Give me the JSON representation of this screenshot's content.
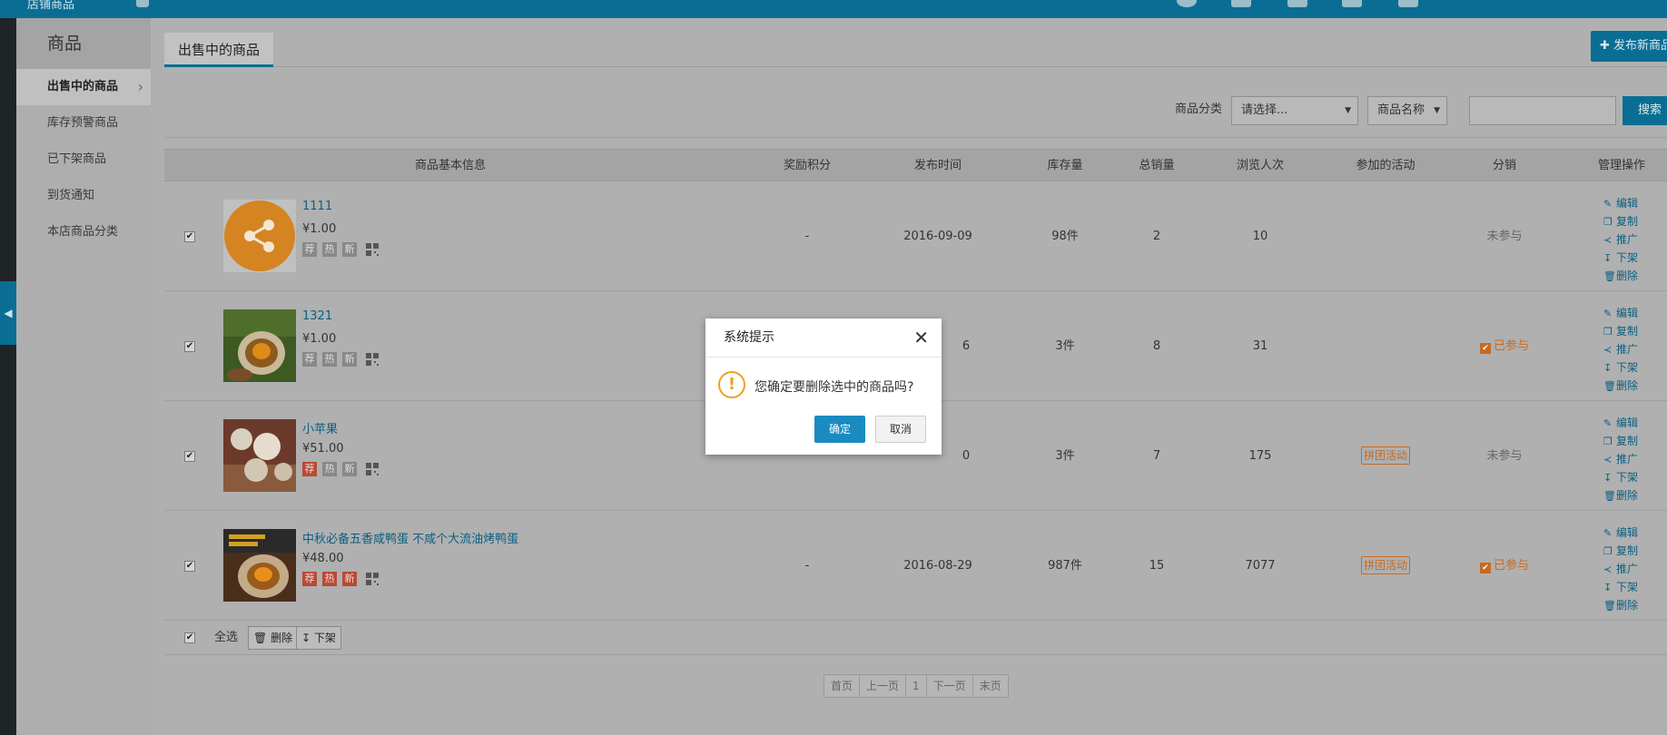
{
  "topbar": {
    "title": "店铺商品"
  },
  "sidebar": {
    "heading": "商品",
    "items": [
      {
        "label": "出售中的商品",
        "active": true
      },
      {
        "label": "库存预警商品"
      },
      {
        "label": "已下架商品"
      },
      {
        "label": "到货通知"
      },
      {
        "label": "本店商品分类"
      }
    ]
  },
  "tab": {
    "label": "出售中的商品"
  },
  "publish_button": "发布新商品",
  "filter": {
    "category_label": "商品分类",
    "category_value": "请选择...",
    "field_value": "商品名称",
    "keyword_value": "",
    "search_label": "搜索"
  },
  "table": {
    "headers": [
      "商品基本信息",
      "奖励积分",
      "发布时间",
      "库存量",
      "总销量",
      "浏览人次",
      "参加的活动",
      "分销",
      "管理操作"
    ],
    "rows": [
      {
        "name": "1111",
        "price": "¥1.00",
        "points": "-",
        "date": "2016-09-09",
        "stock": "98件",
        "sales": "2",
        "views": "10",
        "activity": "",
        "distribution": "未参与",
        "distributed": false,
        "tags": [
          "荐",
          "热",
          "新"
        ],
        "red_tags": []
      },
      {
        "name": "1321",
        "price": "¥1.00",
        "points": "",
        "date": "6",
        "stock": "3件",
        "sales": "8",
        "views": "31",
        "activity": "",
        "distribution": "已参与",
        "distributed": true,
        "tags": [
          "荐",
          "热",
          "新"
        ],
        "red_tags": []
      },
      {
        "name": "小苹果",
        "price": "¥51.00",
        "points": "",
        "date": "0",
        "stock": "3件",
        "sales": "7",
        "views": "175",
        "activity": "拼团活动",
        "distribution": "未参与",
        "distributed": false,
        "tags": [
          "荐",
          "热",
          "新"
        ],
        "red_tags": [
          "荐"
        ]
      },
      {
        "name": "中秋必备五香咸鸭蛋 不咸个大流油烤鸭蛋",
        "price": "¥48.00",
        "points": "-",
        "date": "2016-08-29",
        "stock": "987件",
        "sales": "15",
        "views": "7077",
        "activity": "拼团活动",
        "distribution": "已参与",
        "distributed": true,
        "tags": [
          "荐",
          "热",
          "新"
        ],
        "red_tags": [
          "荐",
          "热",
          "新"
        ]
      }
    ],
    "ops": [
      "编辑",
      "复制",
      "推广",
      "下架",
      "删除"
    ]
  },
  "bulk": {
    "select_all": "全选",
    "delete": "删除",
    "unshelve": "下架"
  },
  "pager": [
    "首页",
    "上一页",
    "1",
    "下一页",
    "末页"
  ],
  "dialog": {
    "title": "系统提示",
    "message": "您确定要删除选中的商品吗?",
    "ok": "确定",
    "cancel": "取消"
  },
  "colors": {
    "brand": "#0a6e94",
    "accent": "#c96a1f",
    "dialog_ok": "#1a8bc0"
  }
}
